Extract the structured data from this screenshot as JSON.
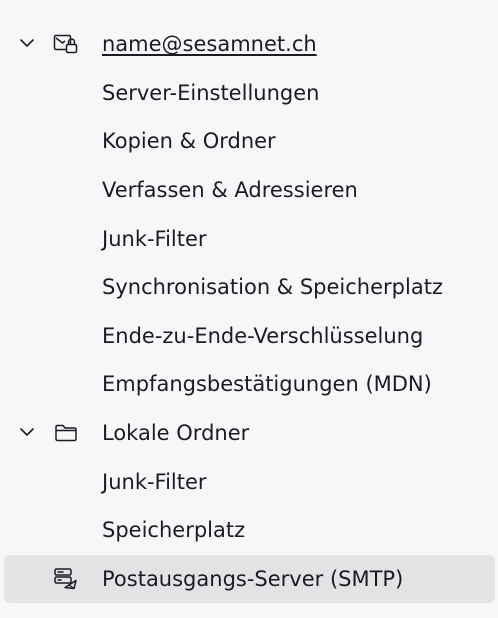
{
  "tree": {
    "account": {
      "label": "name@sesamnet.ch",
      "icon": "mail-account-icon",
      "expanded": true,
      "children": [
        "Server-Einstellungen",
        "Kopien & Ordner",
        "Verfassen & Adressieren",
        "Junk-Filter",
        "Synchronisation & Speicherplatz",
        "Ende-zu-Ende-Verschlüsselung",
        "Empfangsbestätigungen (MDN)"
      ]
    },
    "local_folders": {
      "label": "Lokale Ordner",
      "icon": "folder-icon",
      "expanded": true,
      "children": [
        "Junk-Filter",
        "Speicherplatz"
      ]
    },
    "smtp": {
      "label": "Postausgangs-Server (SMTP)",
      "icon": "outgoing-server-icon",
      "selected": true
    }
  },
  "colors": {
    "background": "#f7f7f9",
    "selected_background": "#e3e3e6",
    "text": "#1c1b22"
  }
}
